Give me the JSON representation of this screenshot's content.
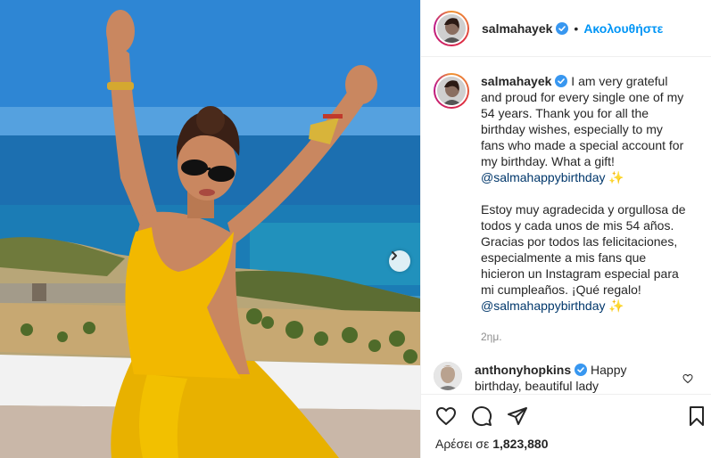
{
  "post": {
    "author": "salmahayek",
    "follow_label": "Ακολουθήστε",
    "dot": "•"
  },
  "caption": {
    "author": "salmahayek",
    "text_en": "I am very grateful and proud for every single one of my 54 years. Thank you for all the birthday wishes, especially to my fans who made a special account for my birthday. What a gift!",
    "mention_1": "@salmahappybirthday",
    "emoji_1": "✨",
    "text_es": "Estoy muy agradecida y orgullosa de todos y cada unos de mis 54 años. Gracias por todos las felicitaciones, especialmente a mis fans que hicieron un Instagram especial para mi cumpleaños. ¡Qué regalo!",
    "mention_2": "@salmahappybirthday",
    "emoji_2": "✨",
    "timestamp": "2ημ."
  },
  "comment": {
    "author": "anthonyhopkins",
    "text": "Happy birthday, beautiful lady"
  },
  "likes": {
    "prefix": "Αρέσει σε",
    "count": "1,823,880"
  },
  "icons": [
    "verified-badge",
    "next-arrow",
    "heart",
    "comment",
    "share",
    "bookmark"
  ],
  "colors": {
    "link": "#0095f6",
    "mention": "#00376b",
    "verified": "#3897f0",
    "muted": "#8e8e8e"
  }
}
